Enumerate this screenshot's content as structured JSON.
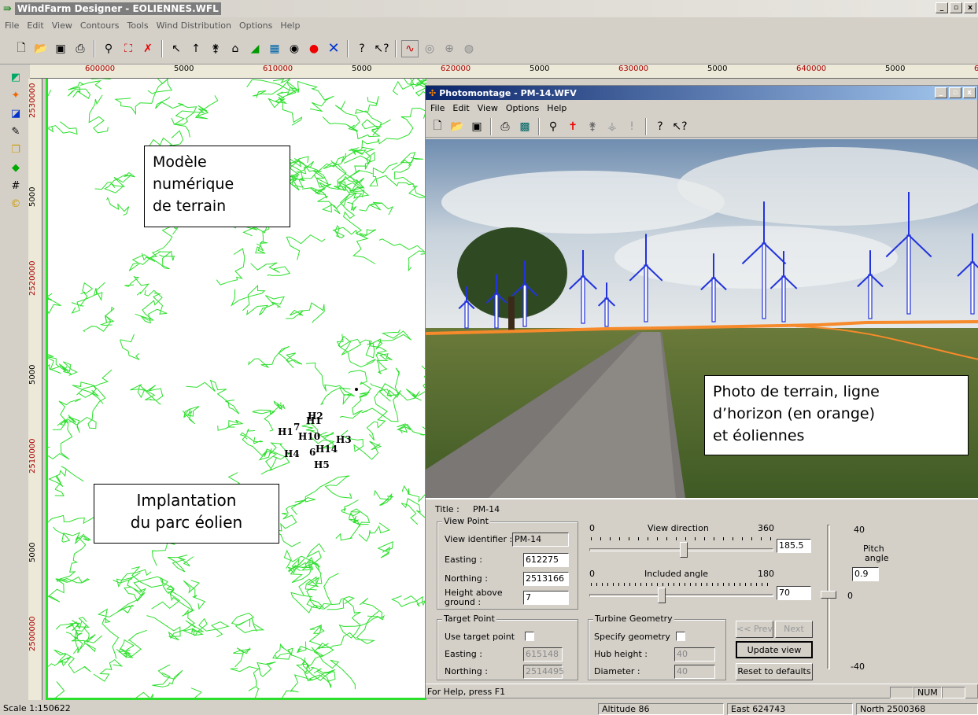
{
  "app": {
    "title": "WindFarm Designer - EOLIENNES.WFL",
    "win_buttons": [
      "_",
      "□",
      "X"
    ]
  },
  "menu": [
    "File",
    "Edit",
    "View",
    "Contours",
    "Tools",
    "Wind Distribution",
    "Options",
    "Help"
  ],
  "ruler_h": [
    {
      "t": "600000",
      "m": true
    },
    {
      "t": "5000",
      "m": false
    },
    {
      "t": "610000",
      "m": true
    },
    {
      "t": "5000",
      "m": false
    },
    {
      "t": "620000",
      "m": true
    },
    {
      "t": "5000",
      "m": false
    },
    {
      "t": "630000",
      "m": true
    },
    {
      "t": "5000",
      "m": false
    },
    {
      "t": "640000",
      "m": true
    },
    {
      "t": "5000",
      "m": false
    },
    {
      "t": "6",
      "m": true
    }
  ],
  "ruler_v": [
    {
      "t": "2530000",
      "m": true
    },
    {
      "t": "5000",
      "m": false
    },
    {
      "t": "2520000",
      "m": true
    },
    {
      "t": "5000",
      "m": false
    },
    {
      "t": "2510000",
      "m": true
    },
    {
      "t": "5000",
      "m": false
    },
    {
      "t": "2500000",
      "m": true
    }
  ],
  "callouts": {
    "terrain": [
      "Modèle",
      "numérique",
      "de terrain"
    ],
    "park": [
      "Implantation",
      "du parc éolien"
    ],
    "photo": [
      "Photo de terrain, ligne",
      "d’horizon (en orange)",
      "et éoliennes"
    ]
  },
  "turbine_labels": [
    "H2",
    "H1",
    "H3",
    "H4",
    "H5",
    "H1",
    "H10",
    "H14",
    "6",
    "7"
  ],
  "pm": {
    "title": "Photomontage - PM-14.WFV",
    "menu": [
      "File",
      "Edit",
      "View",
      "Options",
      "Help"
    ],
    "panel": {
      "title_label": "Title :",
      "title_value": "PM-14",
      "viewpoint": {
        "label": "View Point",
        "id_label": "View identifier :",
        "id_value": "PM-14",
        "easting_label": "Easting :",
        "easting": "612275",
        "northing_label": "Northing :",
        "northing": "2513166",
        "height_label": "Height above",
        "height_label2": "ground :",
        "height": "7"
      },
      "target": {
        "label": "Target Point",
        "use_label": "Use target point",
        "easting_label": "Easting :",
        "easting": "615148",
        "northing_label": "Northing :",
        "northing": "2514495"
      },
      "direction": {
        "min": "0",
        "label": "View direction",
        "max": "360",
        "value": "185.5",
        "fraction": 0.515
      },
      "included": {
        "min": "0",
        "label": "Included angle",
        "max": "180",
        "value": "70",
        "fraction": 0.39
      },
      "pitch": {
        "top": "40",
        "label": "Pitch",
        "label2": "angle",
        "value": "0.9",
        "zero": "0",
        "bottom": "-40"
      },
      "geometry": {
        "label": "Turbine Geometry",
        "specify_label": "Specify geometry",
        "hub_label": "Hub height :",
        "hub": "40",
        "diam_label": "Diameter :",
        "diam": "40"
      },
      "buttons": {
        "prev": "<< Prev",
        "next": "Next >>",
        "update": "Update view",
        "reset": "Reset to defaults"
      }
    },
    "status": {
      "help": "For Help, press F1",
      "num": "NUM"
    }
  },
  "status": {
    "scale": "Scale 1:150622",
    "altitude": "Altitude  86",
    "east": "East  624743",
    "north": "North  2500368"
  }
}
